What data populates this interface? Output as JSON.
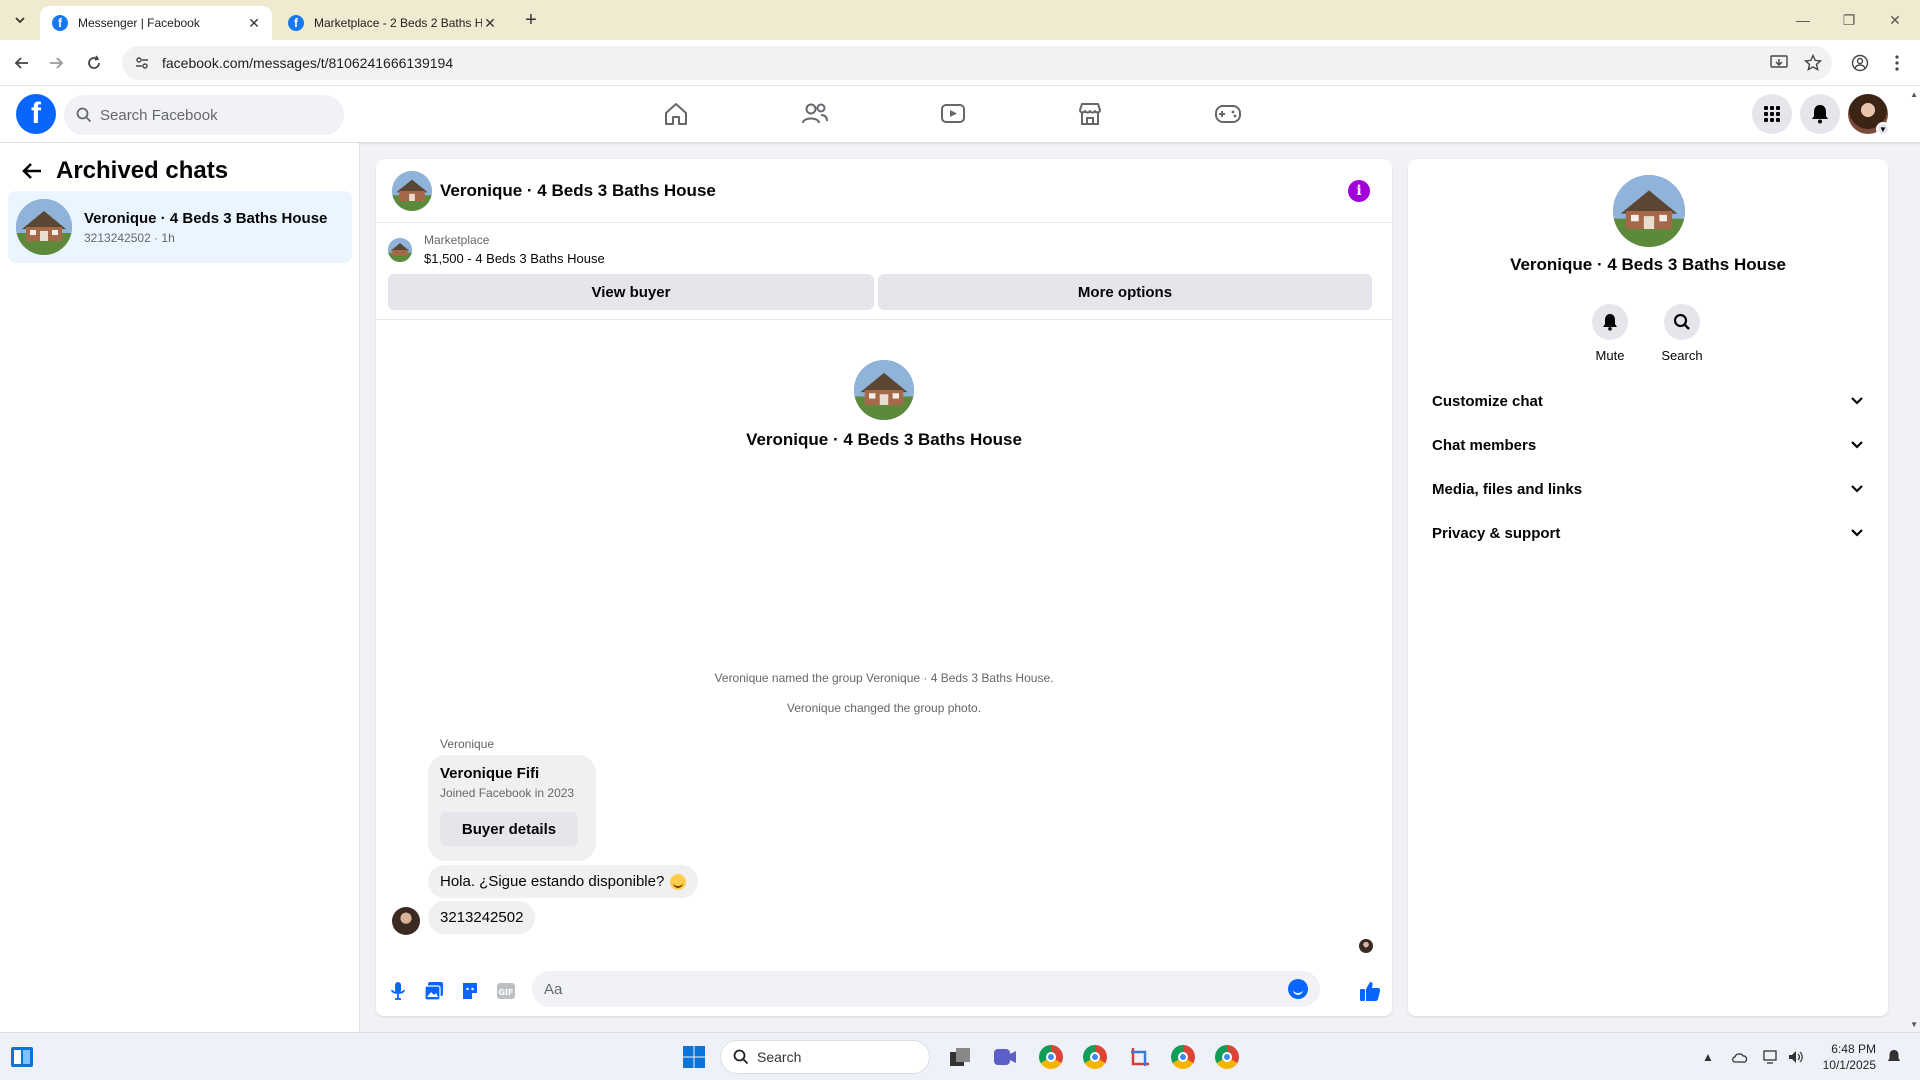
{
  "browser": {
    "tabs": [
      {
        "title": "Messenger | Facebook",
        "active": true
      },
      {
        "title": "Marketplace - 2 Beds 2 Baths H",
        "active": false
      }
    ],
    "url": "facebook.com/messages/t/8106241666139194"
  },
  "fbnav": {
    "logo": "f",
    "search_placeholder": "Search Facebook",
    "icons": [
      "home-icon",
      "friends-icon",
      "video-icon",
      "marketplace-icon",
      "gaming-icon",
      "menu-grid-icon",
      "notifications-icon"
    ]
  },
  "sidebar": {
    "title": "Archived chats",
    "chats": [
      {
        "name": "Veronique · 4 Beds 3 Baths House",
        "sub": "3213242502 · 1h"
      }
    ]
  },
  "conversation": {
    "title": "Veronique · 4 Beds 3 Baths House",
    "marketplace_label": "Marketplace",
    "listing": "$1,500 - 4 Beds 3 Baths House",
    "view_buyer": "View buyer",
    "more_options": "More options",
    "intro_name": "Veronique · 4 Beds 3 Baths House",
    "system_messages": [
      "Veronique named the group Veronique · 4 Beds 3 Baths House.",
      "Veronique changed the group photo."
    ],
    "sender": "Veronique",
    "card": {
      "name": "Veronique Fifi",
      "joined": "Joined Facebook in 2023",
      "button": "Buyer details"
    },
    "messages": [
      "Hola. ¿Sigue estando disponible?",
      "3213242502"
    ],
    "composer_placeholder": "Aa"
  },
  "details": {
    "name": "Veronique · 4 Beds 3 Baths House",
    "actions": [
      {
        "label": "Mute",
        "icon": "bell-icon"
      },
      {
        "label": "Search",
        "icon": "search-icon"
      }
    ],
    "sections": [
      "Customize chat",
      "Chat members",
      "Media, files and links",
      "Privacy & support"
    ]
  },
  "taskbar": {
    "search_placeholder": "Search",
    "time": "6:48 PM",
    "date": "10/1/2025"
  },
  "colors": {
    "brand": "#0866ff",
    "selected_chat": "#ebf5ff",
    "info": "#a100d9"
  }
}
